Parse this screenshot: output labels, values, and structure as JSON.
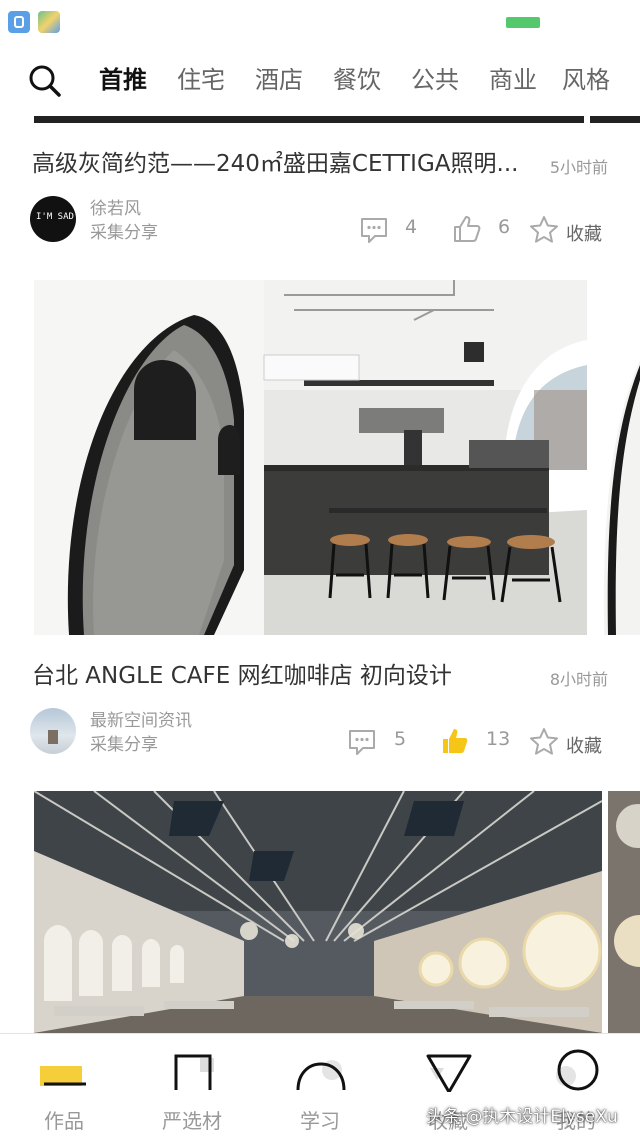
{
  "colors": {
    "accent_yellow": "#f5c518",
    "text_dark": "#333333",
    "text_muted": "#999999",
    "battery_green": "#54c86c"
  },
  "top_nav": {
    "search_icon": "search-icon",
    "tabs": [
      {
        "label": "首推",
        "active": true
      },
      {
        "label": "住宅",
        "active": false
      },
      {
        "label": "酒店",
        "active": false
      },
      {
        "label": "餐饮",
        "active": false
      },
      {
        "label": "公共",
        "active": false
      },
      {
        "label": "商业",
        "active": false
      },
      {
        "label": "风格",
        "active": false
      }
    ]
  },
  "feed": [
    {
      "title": "高级灰简约范——240㎡盛田嘉CETTIGA照明...",
      "time": "5小时前",
      "author": "徐若风",
      "author_sub": "采集分享",
      "avatar_text": "I'M SAD ☹",
      "comments": "4",
      "likes": "6",
      "liked": false,
      "fav_label": "收藏"
    },
    {
      "title": "台北 ANGLE CAFE 网红咖啡店  初向设计",
      "time": "8小时前",
      "author": "最新空间资讯",
      "author_sub": "采集分享",
      "comments": "5",
      "likes": "13",
      "liked": true,
      "fav_label": "收藏"
    }
  ],
  "bottom_nav": {
    "items": [
      {
        "label": "作品",
        "icon": "works-dash-icon",
        "active": true
      },
      {
        "label": "严选材",
        "icon": "materials-frame-icon",
        "active": false
      },
      {
        "label": "学习",
        "icon": "learn-arch-icon",
        "active": false
      },
      {
        "label": "收藏",
        "icon": "favorites-triangle-icon",
        "active": false
      },
      {
        "label": "我的",
        "icon": "profile-circle-icon",
        "active": false
      }
    ]
  },
  "watermark": "头条 @执木设计ElyseXu"
}
